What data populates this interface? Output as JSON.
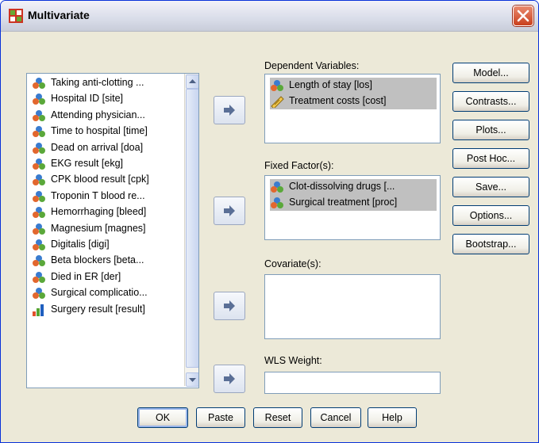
{
  "window": {
    "title": "Multivariate"
  },
  "source_list": {
    "items": [
      {
        "label": "Taking anti-clotting ...",
        "icon": "nominal-icon"
      },
      {
        "label": "Hospital ID [site]",
        "icon": "nominal-icon"
      },
      {
        "label": "Attending physician...",
        "icon": "nominal-icon"
      },
      {
        "label": "Time to hospital [time]",
        "icon": "nominal-icon"
      },
      {
        "label": "Dead on arrival [doa]",
        "icon": "nominal-icon"
      },
      {
        "label": "EKG result [ekg]",
        "icon": "nominal-icon"
      },
      {
        "label": "CPK blood result [cpk]",
        "icon": "nominal-icon"
      },
      {
        "label": "Troponin T blood re...",
        "icon": "nominal-icon"
      },
      {
        "label": "Hemorrhaging [bleed]",
        "icon": "nominal-icon"
      },
      {
        "label": "Magnesium [magnes]",
        "icon": "nominal-icon"
      },
      {
        "label": "Digitalis [digi]",
        "icon": "nominal-icon"
      },
      {
        "label": "Beta blockers [beta...",
        "icon": "nominal-icon"
      },
      {
        "label": "Died in ER [der]",
        "icon": "nominal-icon"
      },
      {
        "label": "Surgical complicatio...",
        "icon": "nominal-icon"
      },
      {
        "label": "Surgery result [result]",
        "icon": "ordinal-icon"
      }
    ]
  },
  "dependent": {
    "label": "Dependent Variables:",
    "items": [
      {
        "label": "Length of stay [los]",
        "icon": "nominal-icon"
      },
      {
        "label": "Treatment costs [cost]",
        "icon": "scale-icon"
      }
    ]
  },
  "fixed": {
    "label": "Fixed Factor(s):",
    "items": [
      {
        "label": "Clot-dissolving drugs [...",
        "icon": "nominal-icon"
      },
      {
        "label": "Surgical treatment [proc]",
        "icon": "nominal-icon"
      }
    ]
  },
  "covariate": {
    "label": "Covariate(s):"
  },
  "wls": {
    "label": "WLS Weight:",
    "value": ""
  },
  "side_buttons": {
    "model": "Model...",
    "contrasts": "Contrasts...",
    "plots": "Plots...",
    "post_hoc": "Post Hoc...",
    "save": "Save...",
    "options": "Options...",
    "bootstrap": "Bootstrap..."
  },
  "bottom_buttons": {
    "ok": "OK",
    "paste": "Paste",
    "reset": "Reset",
    "cancel": "Cancel",
    "help": "Help"
  }
}
